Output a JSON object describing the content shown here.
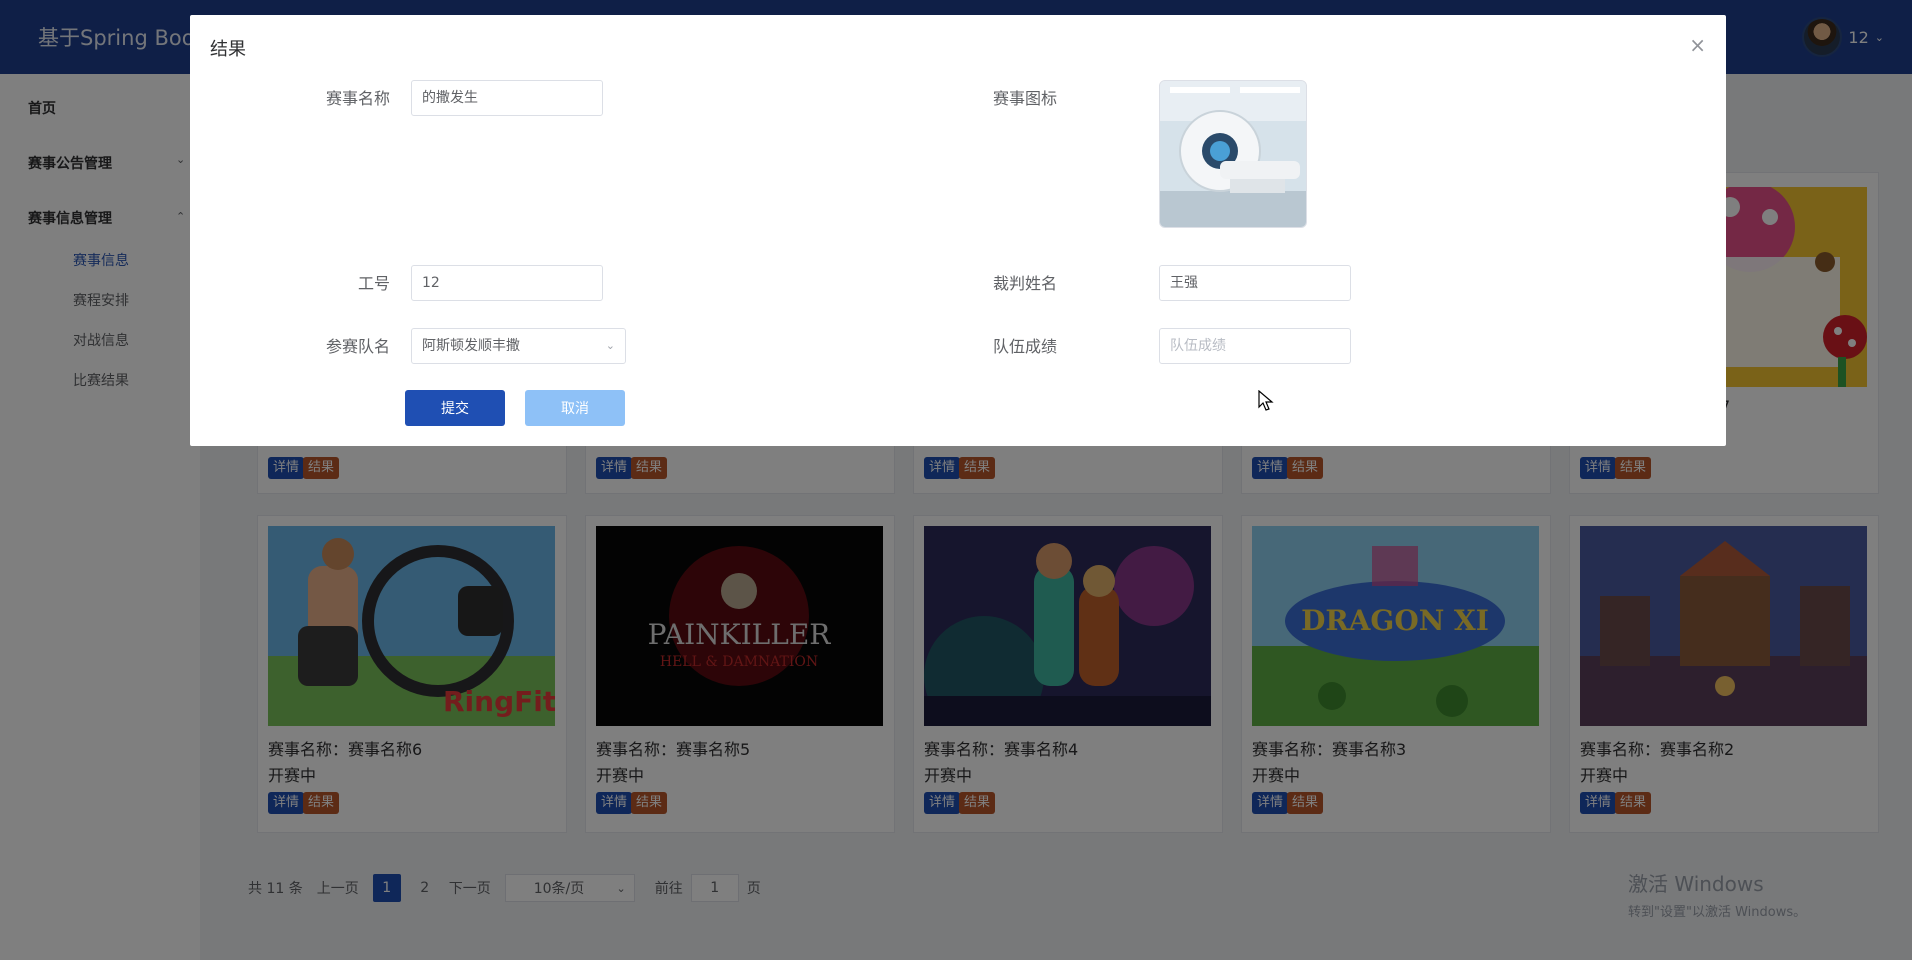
{
  "header": {
    "app_title": "基于Spring Boot",
    "user_name": "12",
    "user_caret": "⌄"
  },
  "sidebar": {
    "home": "首页",
    "notice": "赛事公告管理",
    "info": "赛事信息管理",
    "subs": [
      "赛事信息",
      "赛程安排",
      "对战信息",
      "比赛结果"
    ],
    "caret_down": "⌄",
    "caret_up": "⌃"
  },
  "cards_top": [
    {
      "detail": "详情",
      "result": "结果"
    },
    {
      "detail": "详情",
      "result": "结果"
    },
    {
      "detail": "详情",
      "result": "结果"
    },
    {
      "detail": "详情",
      "result": "结果"
    },
    {
      "detail": "详情",
      "result": "结果"
    }
  ],
  "cards": [
    {
      "name": "赛事名称：赛事名称6",
      "status": "开赛中",
      "detail": "详情",
      "result": "结果",
      "image": "ring-fit-art"
    },
    {
      "name": "赛事名称：赛事名称5",
      "status": "开赛中",
      "detail": "详情",
      "result": "结果",
      "image": "painkiller-art"
    },
    {
      "name": "赛事名称：赛事名称4",
      "status": "开赛中",
      "detail": "详情",
      "result": "结果",
      "image": "fantasy-art"
    },
    {
      "name": "赛事名称：赛事名称3",
      "status": "开赛中",
      "detail": "详情",
      "result": "结果",
      "image": "dragon-quest-art"
    },
    {
      "name": "赛事名称：赛事名称2",
      "status": "开赛中",
      "detail": "详情",
      "result": "结果",
      "image": "castle-art"
    }
  ],
  "partial_card_text": "7",
  "pagination": {
    "total": "共 11 条",
    "prev": "上一页",
    "pages": [
      "1",
      "2"
    ],
    "next": "下一页",
    "page_size": "10条/页",
    "goto_label": "前往",
    "goto_value": "1",
    "page_unit": "页"
  },
  "watermark": {
    "line1": "激活 Windows",
    "line2": "转到\"设置\"以激活 Windows。"
  },
  "dialog": {
    "title": "结果",
    "close": "×",
    "event_name_label": "赛事名称",
    "event_name_value": "的撒发生",
    "event_icon_label": "赛事图标",
    "event_icon_image": "mri-scanner-photo",
    "staff_id_label": "工号",
    "staff_id_value": "12",
    "referee_name_label": "裁判姓名",
    "referee_name_value": "王强",
    "team_name_label": "参赛队名",
    "team_name_value": "阿斯顿发顺丰撒",
    "team_score_label": "队伍成绩",
    "team_score_placeholder": "队伍成绩",
    "submit": "提交",
    "cancel": "取消"
  }
}
